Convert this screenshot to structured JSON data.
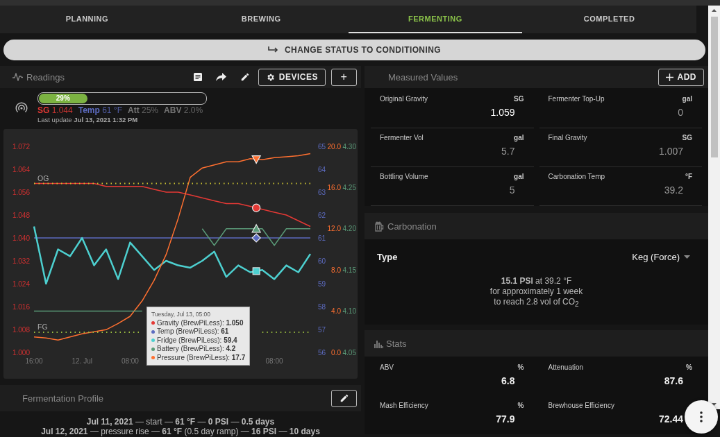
{
  "tabs": [
    {
      "label": "PLANNING",
      "selected": false
    },
    {
      "label": "BREWING",
      "selected": false
    },
    {
      "label": "FERMENTING",
      "selected": true
    },
    {
      "label": "COMPLETED",
      "selected": false
    }
  ],
  "status_button": {
    "label": "CHANGE STATUS TO CONDITIONING"
  },
  "readings": {
    "title": "Readings",
    "devices_button": "DEVICES",
    "add_button": "+",
    "progress": {
      "level": 0.29,
      "label": "29%"
    },
    "values": [
      {
        "label": "SG",
        "value": "1.044",
        "color": "#e53935"
      },
      {
        "label": "Temp",
        "value": "61 °F",
        "color": "#5c6bc0"
      },
      {
        "label": "Att",
        "value": "25%",
        "color": "#757575"
      },
      {
        "label": "ABV",
        "value": "2.0%",
        "color": "#757575"
      }
    ],
    "last_update": "Last update **Jul 13, 2021 1:32 PM**",
    "chart_data": {
      "type": "line",
      "categories": [
        "16:00",
        null,
        null,
        null,
        "12. Jul",
        null,
        null,
        null,
        "08:00",
        null,
        null,
        null,
        null,
        null,
        null,
        null,
        null,
        null,
        null,
        null,
        "08:00",
        null,
        null,
        null
      ],
      "ylim": [
        1.0,
        1.072
      ],
      "yticks": [
        {
          "value": 1.0,
          "label": "1.000"
        },
        {
          "value": 1.008,
          "label": "1.008"
        },
        {
          "value": 1.016,
          "label": "1.016"
        },
        {
          "value": 1.024,
          "label": "1.024"
        },
        {
          "value": 1.032,
          "label": "1.032"
        },
        {
          "value": 1.04,
          "label": "1.040"
        },
        {
          "value": 1.048,
          "label": "1.048"
        },
        {
          "value": 1.056,
          "label": "1.056"
        },
        {
          "value": 1.064,
          "label": "1.064"
        },
        {
          "value": 1.072,
          "label": "1.072"
        }
      ],
      "y2lim": [
        56,
        65
      ],
      "y2ticks": [
        56,
        57,
        58,
        59,
        60,
        61,
        62,
        63,
        64,
        65
      ],
      "y3lim": [
        0,
        20
      ],
      "y3ticks": [
        {
          "value": 0,
          "label": "0.0"
        },
        {
          "value": 4,
          "label": "4.0"
        },
        {
          "value": 8,
          "label": "8.0"
        },
        {
          "value": 12,
          "label": "12.0"
        },
        {
          "value": 16,
          "label": "16.0"
        },
        {
          "value": 20,
          "label": "20.0"
        }
      ],
      "series": [
        {
          "color": "#e53935",
          "values": [
            1.059,
            1.059,
            1.059,
            1.059,
            1.059,
            1.059,
            1.058,
            1.058,
            1.058,
            1.058,
            1.057,
            1.056,
            1.056,
            1.055,
            1.054,
            1.053,
            1.052,
            1.052,
            1.051,
            1.05,
            1.049,
            1.048,
            1.046,
            1.044
          ]
        },
        {
          "color": "#5c6bc0",
          "axis": "y2",
          "values": [
            61,
            61,
            61,
            61,
            61,
            61,
            61,
            61,
            61,
            61,
            61,
            61,
            61,
            61,
            61,
            61,
            61,
            61,
            61,
            61,
            61,
            61,
            61,
            61
          ]
        },
        {
          "color": "#4dd0d0",
          "axis": "y2",
          "values": [
            61.5,
            59,
            60.5,
            60.2,
            61,
            59.8,
            60.5,
            59.2,
            60.8,
            60.2,
            59.6,
            60,
            59.8,
            59.7,
            60,
            60.4,
            59.3,
            59.8,
            59.5,
            59.6,
            59.2,
            59.8,
            59.5,
            60.3
          ]
        },
        {
          "color": "#ff7030",
          "axis": "y3",
          "values": [
            1.5,
            1.4,
            1.2,
            1.5,
            1.8,
            2.0,
            2.2,
            2.8,
            3.5,
            5,
            7,
            9.5,
            13,
            17,
            17.9,
            18.2,
            18.5,
            18.5,
            18.8,
            18.7,
            18.9,
            19.0,
            19.1,
            19.3
          ]
        },
        {
          "name": "OG",
          "color": "#c8c030",
          "line_style": "dotted",
          "values": [
            1.059,
            1.059,
            1.059,
            1.059,
            1.059,
            1.059,
            1.059,
            1.059,
            1.059,
            1.059,
            1.059,
            1.059,
            1.059,
            1.059,
            1.059,
            1.059,
            1.059,
            1.059,
            1.059,
            1.059,
            1.059,
            1.059,
            1.059,
            1.059
          ]
        },
        {
          "name": "FG",
          "color": "#9cc040",
          "line_style": "dotted",
          "values": [
            1.007,
            1.007,
            1.007,
            1.007,
            1.007,
            1.007,
            1.007,
            1.007,
            1.007,
            1.007,
            null,
            null,
            null,
            null,
            null,
            null,
            null,
            null,
            null,
            1.007,
            1.007,
            1.007,
            1.007,
            1.007
          ]
        }
      ]
    },
    "battery": {
      "chart_data": {
        "type": "line",
        "ylim": [
          4.05,
          4.3
        ],
        "yticks": [
          {
            "value": 4.3,
            "label": "4.30"
          },
          {
            "value": 4.25,
            "label": "4.25"
          },
          {
            "value": 4.2,
            "label": "4.20"
          },
          {
            "value": 4.15,
            "label": "4.15"
          },
          {
            "value": 4.1,
            "label": "4.10"
          },
          {
            "value": 4.05,
            "label": "4.05"
          }
        ],
        "series": [
          {
            "color": "#5a9a78",
            "values": [
              4.1,
              4.1,
              4.1,
              4.1,
              4.1,
              4.1,
              4.1,
              4.1,
              4.1,
              4.1,
              null,
              null,
              null,
              null,
              4.2,
              4.18,
              4.2,
              4.2,
              4.2,
              4.2,
              4.18,
              4.2,
              4.2,
              4.2
            ]
          }
        ]
      }
    },
    "tooltip": {
      "title": "Tuesday, Jul 13, 05:00",
      "items": [
        {
          "text": "Gravity (BrewPiLess): **1.050**",
          "color": "#e53935"
        },
        {
          "text": "Temp (BrewPiLess): **61**",
          "color": "#5c6bc0"
        },
        {
          "text": "Fridge (BrewPiLess): **59.4**",
          "color": "#4dd0d0"
        },
        {
          "text": "Battery (BrewPiLess): **4.2**",
          "color": "#5a9a78"
        },
        {
          "text": "Pressure (BrewPiLess): **17.7**",
          "color": "#ff7030"
        }
      ]
    }
  },
  "profile": {
    "title": "Fermentation Profile",
    "steps": [
      "**Jul 11, 2021** — start — **61 °F** — **0 PSI** — **0.5 days**",
      "**Jul 12, 2021** — pressure rise — **61 °F** (0.5 day ramp) — **16 PSI** — **10 days**"
    ]
  },
  "measured": {
    "title": "Measured Values",
    "add_button": "ADD",
    "fields": [
      {
        "label": "Original Gravity",
        "unit": "SG",
        "value": "1.059",
        "highlighted": true
      },
      {
        "label": "Fermenter Top-Up",
        "unit": "gal",
        "value": "0",
        "highlighted": false
      },
      {
        "label": "Fermenter Vol",
        "unit": "gal",
        "value": "5.7",
        "highlighted": false
      },
      {
        "label": "Final Gravity",
        "unit": "SG",
        "value": "1.007",
        "highlighted": false
      },
      {
        "label": "Bottling Volume",
        "unit": "gal",
        "value": "5",
        "highlighted": false
      },
      {
        "label": "Carbonation Temp",
        "unit": "°F",
        "value": "39.2",
        "highlighted": false
      }
    ]
  },
  "carbonation": {
    "title": "Carbonation",
    "type_label": "Type",
    "type_value": "Keg (Force)",
    "lines": [
      "**15.1 PSI** at 39.2 °F",
      "for approximately 1 week",
      "to reach 2.8 vol of CO$_{2}$"
    ]
  },
  "stats": {
    "title": "Stats",
    "fields": [
      {
        "label": "ABV",
        "unit": "%",
        "value": "6.8"
      },
      {
        "label": "Attenuation",
        "unit": "%",
        "value": "87.6"
      },
      {
        "label": "Mash Efficiency",
        "unit": "%",
        "value": "77.9"
      },
      {
        "label": "Brewhouse Efficiency",
        "value": "72.44"
      }
    ]
  }
}
